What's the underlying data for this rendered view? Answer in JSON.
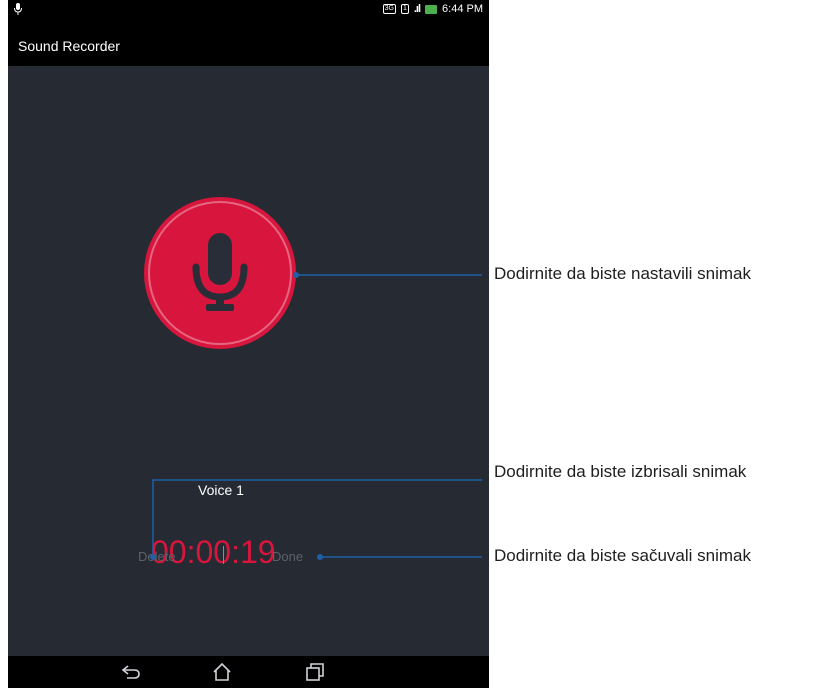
{
  "status_bar": {
    "network_badge": "3G",
    "sim_badge": "1",
    "time": "6:44 PM"
  },
  "app": {
    "title": "Sound Recorder"
  },
  "recording": {
    "name": "Voice 1",
    "elapsed": "00:00:19"
  },
  "controls": {
    "delete_label": "Delete",
    "done_label": "Done"
  },
  "callouts": {
    "record": "Dodirnite da biste nastavili snimak",
    "delete": "Dodirnite da biste izbrisali snimak",
    "done": "Dodirnite da biste sačuvali snimak"
  },
  "colors": {
    "accent": "#d8153d",
    "background": "#262a32",
    "bar": "#000000",
    "callout_line": "#1f5fa8"
  },
  "icons": {
    "record": "microphone-icon",
    "back": "back-icon",
    "home": "home-icon",
    "recents": "recents-icon"
  }
}
